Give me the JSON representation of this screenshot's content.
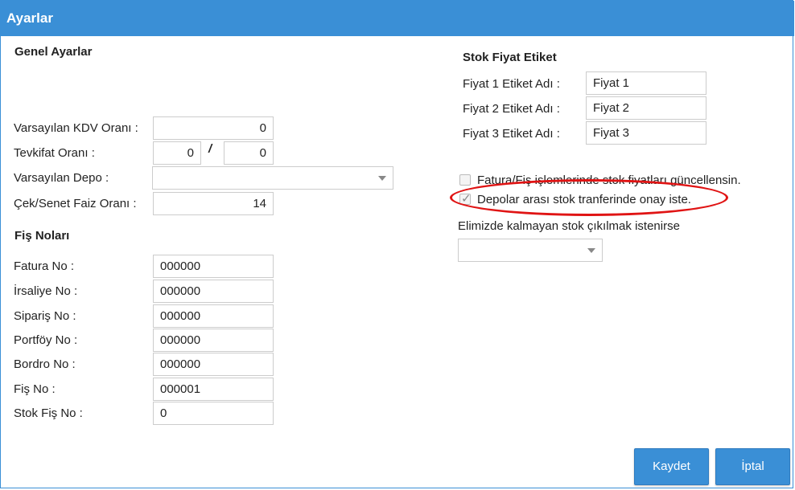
{
  "window": {
    "title": "Ayarlar"
  },
  "general": {
    "title": "Genel Ayarlar",
    "kdv": {
      "label": "Varsayılan KDV Oranı :",
      "value": "0"
    },
    "tevkifat": {
      "label": "Tevkifat Oranı :",
      "value1": "0",
      "separator": "/",
      "value2": "0"
    },
    "depo": {
      "label": "Varsayılan Depo :",
      "value": ""
    },
    "faiz": {
      "label": "Çek/Senet Faiz Oranı :",
      "value": "14"
    }
  },
  "fis": {
    "title": "Fiş Noları",
    "rows": [
      {
        "label": "Fatura No :",
        "value": "000000"
      },
      {
        "label": "İrsaliye No :",
        "value": "000000"
      },
      {
        "label": "Sipariş No :",
        "value": "000000"
      },
      {
        "label": "Portföy No :",
        "value": "000000"
      },
      {
        "label": "Bordro No :",
        "value": "000000"
      },
      {
        "label": "Fiş No :",
        "value": "000001"
      },
      {
        "label": "Stok Fiş No :",
        "value": "0"
      }
    ]
  },
  "stok": {
    "title": "Stok Fiyat Etiket",
    "rows": [
      {
        "label": "Fiyat 1 Etiket Adı :",
        "value": "Fiyat 1"
      },
      {
        "label": "Fiyat 2 Etiket Adı :",
        "value": "Fiyat 2"
      },
      {
        "label": "Fiyat 3 Etiket Adı :",
        "value": "Fiyat 3"
      }
    ]
  },
  "options": {
    "update_prices": {
      "label": "Fatura/Fiş işlemlerinde stok fiyatları güncellensin.",
      "checked": false
    },
    "transfer_approval": {
      "label": "Depolar arası stok tranferinde onay iste.",
      "checked": true
    },
    "out_of_stock": {
      "label": "Elimizde kalmayan stok çıkılmak istenirse",
      "value": ""
    }
  },
  "buttons": {
    "save": "Kaydet",
    "cancel": "İptal"
  },
  "colors": {
    "accent": "#3a8fd6",
    "annotation": "#e01414"
  }
}
